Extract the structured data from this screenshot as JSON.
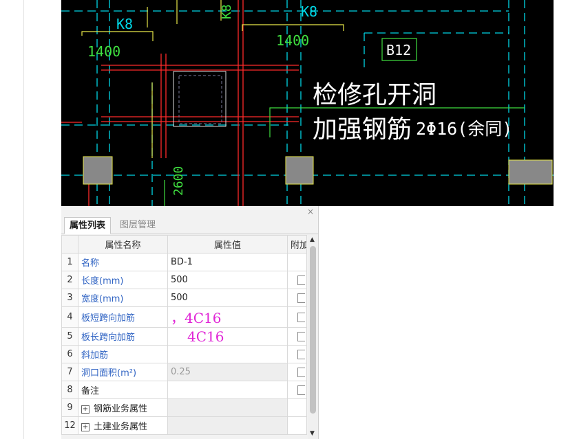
{
  "cad": {
    "labels": {
      "k8_left": "K8",
      "k8_mid": "K8",
      "k8_right": "K8",
      "dim_left": "1400",
      "dim_right": "1400",
      "dim_vertical": "2600",
      "board_id": "B12",
      "note_line1": "检修孔开洞",
      "note_line2": "加强钢筋",
      "note_rebar": "2Φ16(余同)"
    },
    "colors": {
      "background": "#000000",
      "axis_cyan": "#00d7e6",
      "rebar_red": "#ff2a2a",
      "label_yellow": "#e8e84a",
      "dim_green": "#40e040",
      "text_white": "#ffffff",
      "column_gray": "#888888"
    }
  },
  "panel": {
    "close_label": "×",
    "tabs": [
      {
        "label": "属性列表",
        "active": true
      },
      {
        "label": "图层管理",
        "active": false
      }
    ],
    "columns": [
      "属性名称",
      "属性值",
      "附加"
    ],
    "rows": [
      {
        "idx": "1",
        "name": "名称",
        "value": "BD-1"
      },
      {
        "idx": "2",
        "name": "长度(mm)",
        "value": "500"
      },
      {
        "idx": "3",
        "name": "宽度(mm)",
        "value": "500"
      },
      {
        "idx": "4",
        "name": "板短跨向加筋",
        "value": "，4C16"
      },
      {
        "idx": "5",
        "name": "板长跨向加筋",
        "value": "4C16"
      },
      {
        "idx": "6",
        "name": "斜加筋",
        "value": ""
      },
      {
        "idx": "7",
        "name": "洞口面积(m²)",
        "value": "0.25"
      },
      {
        "idx": "8",
        "name": "备注",
        "value": ""
      },
      {
        "idx": "9",
        "name": "钢筋业务属性",
        "value": ""
      },
      {
        "idx": "12",
        "name": "土建业务属性",
        "value": ""
      }
    ],
    "expander_symbol": "+"
  }
}
